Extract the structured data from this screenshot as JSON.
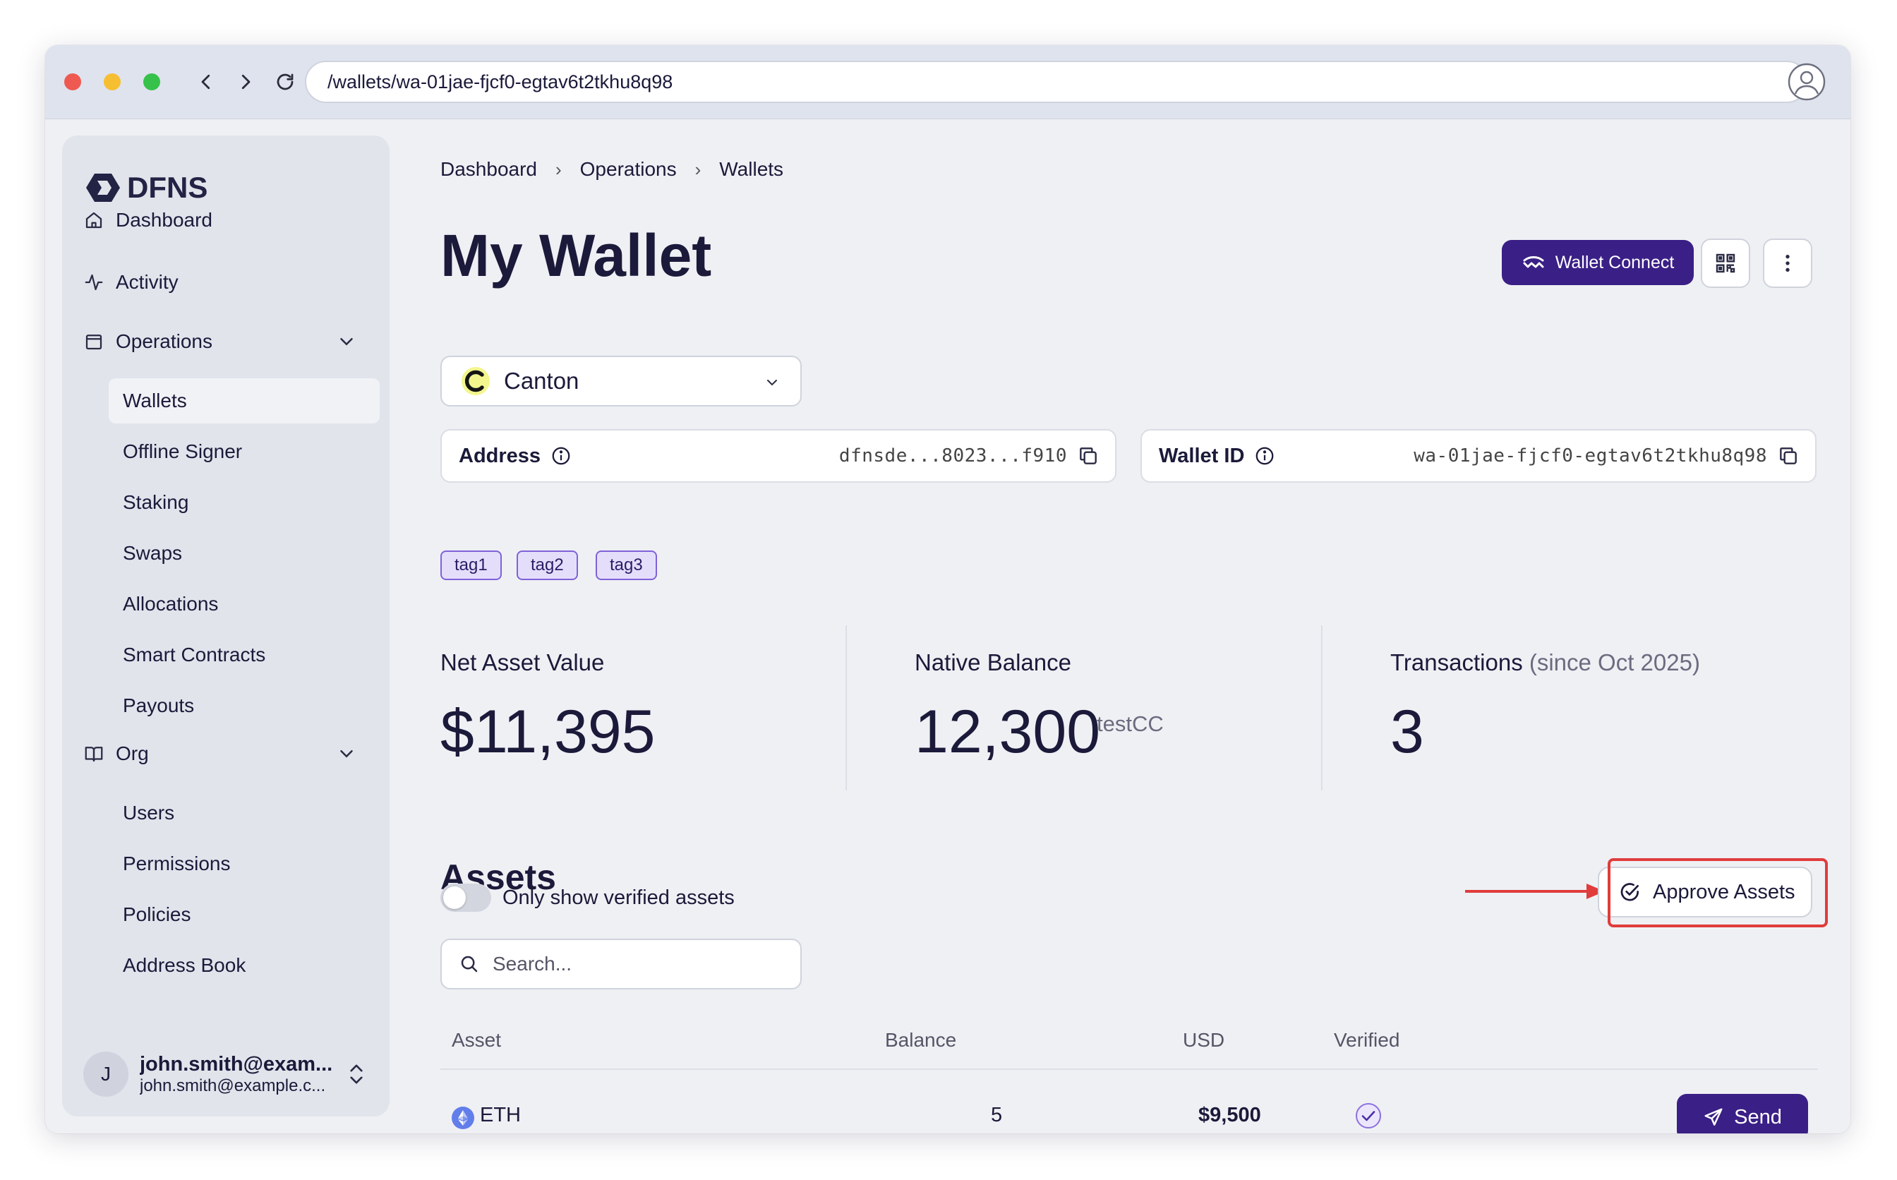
{
  "browser": {
    "url": "/wallets/wa-01jae-fjcf0-egtav6t2tkhu8q98"
  },
  "sidebar": {
    "logo_text": "DFNS",
    "nav": {
      "dashboard": "Dashboard",
      "activity": "Activity",
      "operations": "Operations",
      "org": "Org"
    },
    "operations_items": [
      "Wallets",
      "Offline Signer",
      "Staking",
      "Swaps",
      "Allocations",
      "Smart Contracts",
      "Payouts"
    ],
    "org_items": [
      "Users",
      "Permissions",
      "Policies",
      "Address Book"
    ],
    "active_item": "Wallets",
    "user": {
      "initial": "J",
      "name": "john.smith@exam...",
      "email": "john.smith@example.c..."
    }
  },
  "breadcrumb": [
    "Dashboard",
    "Operations",
    "Wallets"
  ],
  "page": {
    "title": "My Wallet",
    "wallet_connect_label": "Wallet Connect"
  },
  "network": {
    "selected": "Canton"
  },
  "address": {
    "label": "Address",
    "value": "dfnsde...8023...f910"
  },
  "wallet_id": {
    "label": "Wallet ID",
    "value": "wa-01jae-fjcf0-egtav6t2tkhu8q98"
  },
  "tags": [
    "tag1",
    "tag2",
    "tag3"
  ],
  "stats": {
    "net_asset_value": {
      "label": "Net Asset Value",
      "value": "$11,395"
    },
    "native_balance": {
      "label": "Native Balance",
      "value": "12,300",
      "unit": "testCC"
    },
    "transactions": {
      "label": "Transactions",
      "note": "(since Oct 2025)",
      "value": "3"
    }
  },
  "assets": {
    "title": "Assets",
    "approve_label": "Approve Assets",
    "toggle_label": "Only show verified assets",
    "toggle_on": false,
    "search_placeholder": "Search...",
    "columns": {
      "asset": "Asset",
      "balance": "Balance",
      "usd": "USD",
      "verified": "Verified"
    },
    "rows": [
      {
        "asset": "ETH",
        "balance": "5",
        "usd": "$9,500",
        "verified": true,
        "action": "Send"
      }
    ]
  },
  "colors": {
    "primary": "#3a1f86",
    "annotation": "#e03c3c",
    "tag_bg": "#e5defb",
    "tag_border": "#7f62d8"
  },
  "icons": [
    "home-icon",
    "activity-icon",
    "wallet-icon",
    "book-icon",
    "chevron-down-icon",
    "info-icon",
    "copy-icon",
    "qr-code-icon",
    "kebab-menu-icon",
    "check-circle-icon",
    "search-icon",
    "eth-icon",
    "send-icon"
  ]
}
